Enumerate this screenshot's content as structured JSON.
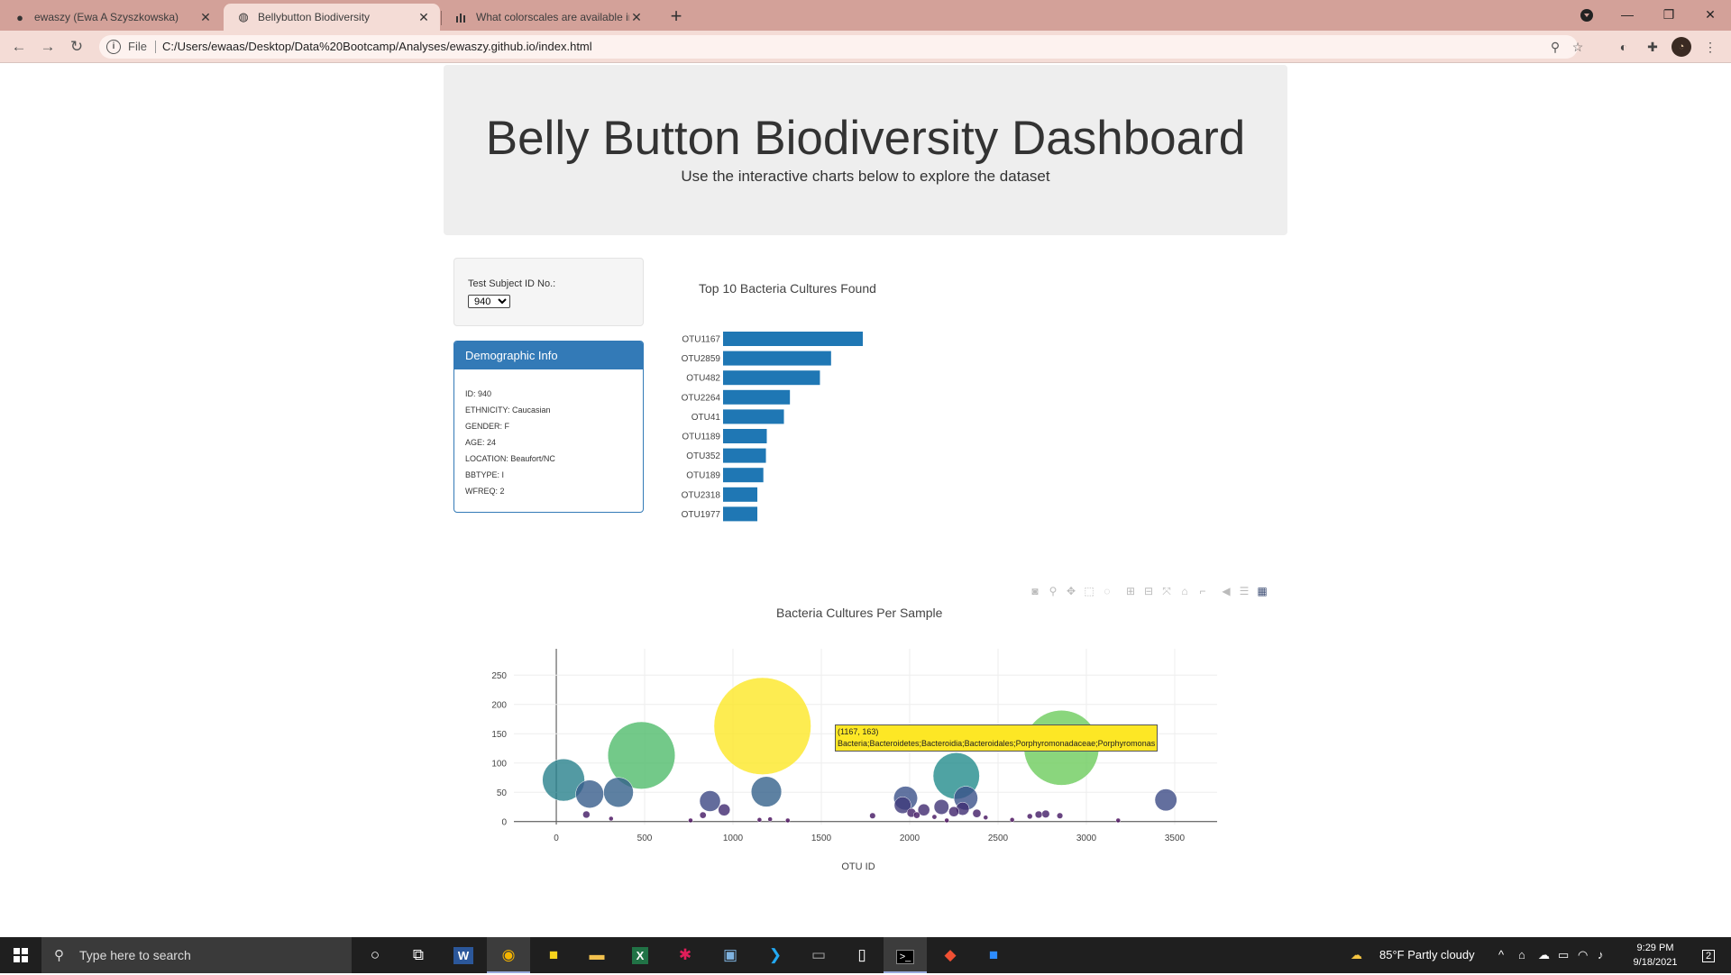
{
  "browser": {
    "tabs": [
      {
        "title": "ewaszy (Ewa A Szyszkowska)",
        "icon": "github-icon"
      },
      {
        "title": "Bellybutton Biodiversity",
        "icon": "globe-icon"
      },
      {
        "title": "What colorscales are available in",
        "icon": "plotly-icon"
      }
    ],
    "url_scheme": "File",
    "url": "C:/Users/ewaas/Desktop/Data%20Bootcamp/Analyses/ewaszy.github.io/index.html"
  },
  "header": {
    "title": "Belly Button Biodiversity Dashboard",
    "subtitle": "Use the interactive charts below to explore the dataset"
  },
  "selector": {
    "label": "Test Subject ID No.:",
    "selected": "940"
  },
  "demographics": {
    "heading": "Demographic Info",
    "rows": [
      "ID: 940",
      "ETHNICITY: Caucasian",
      "GENDER: F",
      "AGE: 24",
      "LOCATION: Beaufort/NC",
      "BBTYPE: I",
      "WFREQ: 2"
    ]
  },
  "chart_data": [
    {
      "type": "bar",
      "orientation": "horizontal",
      "title": "Top 10 Bacteria Cultures Found",
      "categories": [
        "OTU1167",
        "OTU2859",
        "OTU482",
        "OTU2264",
        "OTU41",
        "OTU1189",
        "OTU352",
        "OTU189",
        "OTU2318",
        "OTU1977"
      ],
      "values": [
        163,
        126,
        113,
        78,
        71,
        51,
        50,
        47,
        40,
        40
      ],
      "xlim": [
        0,
        163
      ],
      "xticks": [
        0,
        50,
        100,
        150
      ],
      "color": "#1f77b4"
    },
    {
      "type": "scatter",
      "mode": "bubble",
      "title": "Bacteria Cultures Per Sample",
      "xlabel": "OTU ID",
      "ylabel": "",
      "xlim": [
        -240,
        3740
      ],
      "ylim": [
        -5,
        295
      ],
      "xticks": [
        0,
        500,
        1000,
        1500,
        2000,
        2500,
        3000,
        3500
      ],
      "yticks": [
        0,
        50,
        100,
        150,
        200,
        250
      ],
      "colorscale": "Viridis",
      "points": [
        {
          "x": 1167,
          "y": 163
        },
        {
          "x": 2859,
          "y": 126
        },
        {
          "x": 482,
          "y": 113
        },
        {
          "x": 2264,
          "y": 78
        },
        {
          "x": 41,
          "y": 71
        },
        {
          "x": 1189,
          "y": 51
        },
        {
          "x": 352,
          "y": 50
        },
        {
          "x": 189,
          "y": 47
        },
        {
          "x": 2318,
          "y": 40
        },
        {
          "x": 1977,
          "y": 40
        },
        {
          "x": 3450,
          "y": 37
        },
        {
          "x": 870,
          "y": 35
        },
        {
          "x": 1960,
          "y": 28
        },
        {
          "x": 2180,
          "y": 25
        },
        {
          "x": 2300,
          "y": 22
        },
        {
          "x": 2080,
          "y": 20
        },
        {
          "x": 950,
          "y": 20
        },
        {
          "x": 2250,
          "y": 17
        },
        {
          "x": 2010,
          "y": 15
        },
        {
          "x": 2380,
          "y": 14
        },
        {
          "x": 2770,
          "y": 13
        },
        {
          "x": 2730,
          "y": 12
        },
        {
          "x": 170,
          "y": 12
        },
        {
          "x": 2040,
          "y": 11
        },
        {
          "x": 830,
          "y": 11
        },
        {
          "x": 2850,
          "y": 10
        },
        {
          "x": 1790,
          "y": 10
        },
        {
          "x": 2680,
          "y": 9
        },
        {
          "x": 2140,
          "y": 8
        },
        {
          "x": 2430,
          "y": 7
        },
        {
          "x": 310,
          "y": 5
        },
        {
          "x": 1210,
          "y": 4
        },
        {
          "x": 1150,
          "y": 3
        },
        {
          "x": 2580,
          "y": 3
        },
        {
          "x": 760,
          "y": 2
        },
        {
          "x": 1310,
          "y": 2
        },
        {
          "x": 2210,
          "y": 2
        },
        {
          "x": 3180,
          "y": 2
        }
      ],
      "hover": {
        "text": "(1167, 163)",
        "label": "Bacteria;Bacteroidetes;Bacteroidia;Bacteroidales;Porphyromonadaceae;Porphyromonas"
      }
    }
  ],
  "modebar": [
    "camera-icon",
    "zoom-icon",
    "pan-icon",
    "box-select-icon",
    "lasso-icon",
    "zoom-in-icon",
    "zoom-out-icon",
    "autoscale-icon",
    "reset-axes-icon",
    "spike-lines-icon",
    "hover-closest-icon",
    "hover-compare-icon",
    "plotly-logo-icon"
  ],
  "taskbar": {
    "search_placeholder": "Type here to search",
    "weather": "85°F  Partly cloudy",
    "time": "9:29 PM",
    "date": "9/18/2021",
    "notifications": "2"
  }
}
